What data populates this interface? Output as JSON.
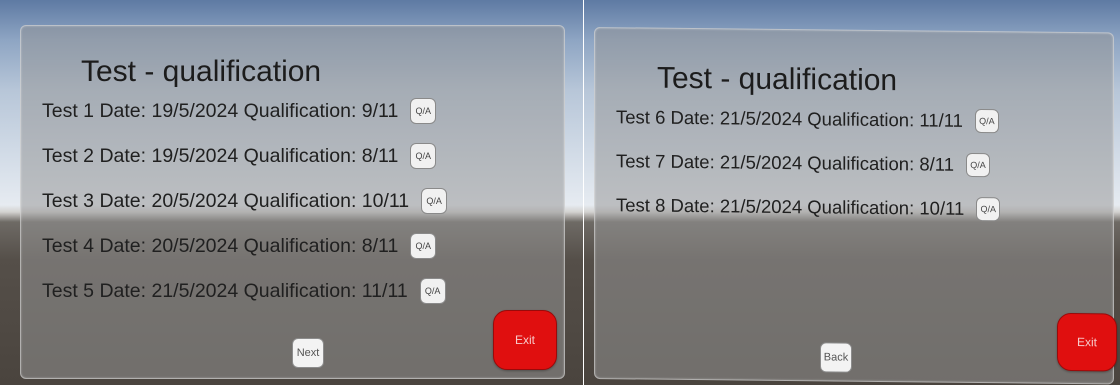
{
  "left_panel": {
    "title": "Test - qualification",
    "rows": [
      "Test 1 Date: 19/5/2024 Qualification: 9/11",
      "Test 2 Date: 19/5/2024 Qualification: 8/11",
      "Test 3 Date: 20/5/2024 Qualification: 10/11",
      "Test 4 Date: 20/5/2024 Qualification: 8/11",
      "Test 5 Date: 21/5/2024 Qualification: 11/11"
    ],
    "qa_label": "Q/A",
    "next_label": "Next",
    "exit_label": "Exit"
  },
  "right_panel": {
    "title": "Test - qualification",
    "rows": [
      "Test 6 Date: 21/5/2024 Qualification: 11/11",
      "Test 7 Date: 21/5/2024 Qualification: 8/11",
      "Test 8 Date: 21/5/2024 Qualification: 10/11"
    ],
    "qa_label": "Q/A",
    "back_label": "Back",
    "exit_label": "Exit"
  },
  "colors": {
    "exit_button": "#e00f0f",
    "panel": "#969696",
    "text": "#202020"
  }
}
